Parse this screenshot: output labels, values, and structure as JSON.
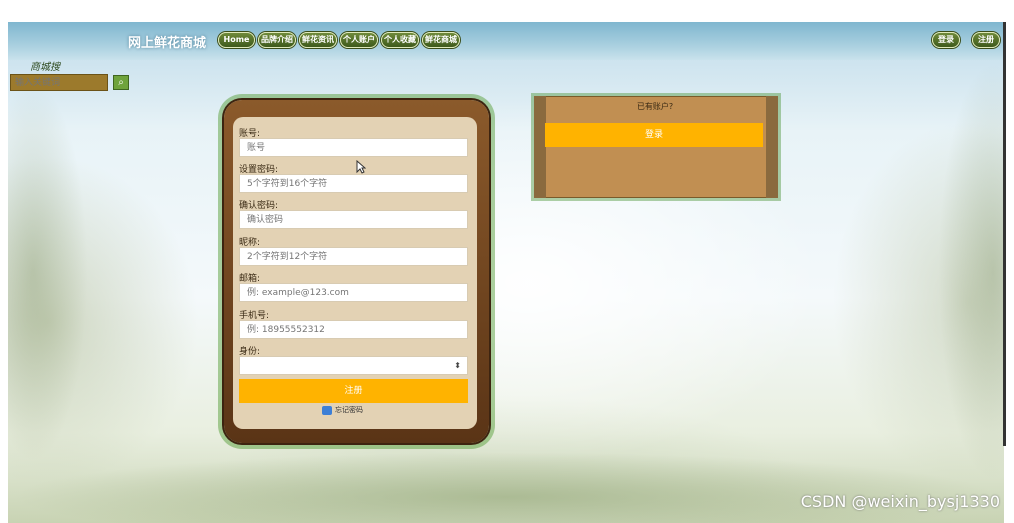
{
  "header": {
    "site_title": "网上鲜花商城",
    "nav_items": [
      "Home",
      "品牌介绍",
      "鲜花资讯",
      "个人账户",
      "个人收藏",
      "鲜花商城"
    ],
    "login_label": "登录",
    "register_label": "注册"
  },
  "search": {
    "label": "商城搜",
    "placeholder": "输入关键词",
    "button_icon": "search-icon"
  },
  "register_form": {
    "fields": [
      {
        "label": "账号:",
        "placeholder": "账号"
      },
      {
        "label": "设置密码:",
        "placeholder": "5个字符到16个字符"
      },
      {
        "label": "确认密码:",
        "placeholder": "确认密码"
      },
      {
        "label": "昵称:",
        "placeholder": "2个字符到12个字符"
      },
      {
        "label": "邮箱:",
        "placeholder": "例: example@123.com"
      },
      {
        "label": "手机号:",
        "placeholder": "例: 18955552312"
      }
    ],
    "role_label": "身份:",
    "role_value": "",
    "submit_label": "注册",
    "remember_label": "忘记密码"
  },
  "login_card": {
    "prompt": "已有账户?",
    "login_button": "登录"
  },
  "watermark": "CSDN @weixin_bysj1330",
  "colors": {
    "accent": "#ffb300",
    "frame_brown": "#8b5a2b",
    "panel_beige": "#e3d2b4",
    "card_tan": "#c18f52"
  }
}
